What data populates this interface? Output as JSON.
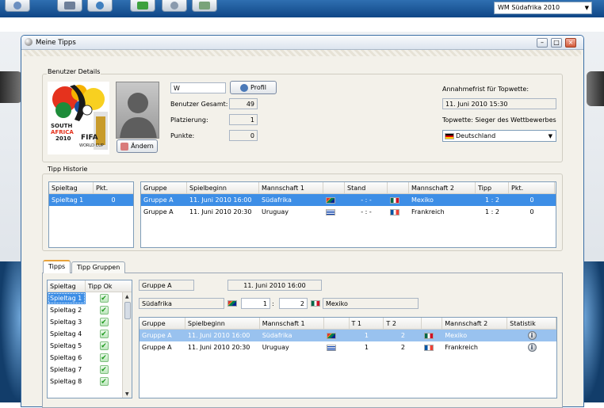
{
  "app": {
    "season_select": "WM Südafrika 2010"
  },
  "window": {
    "title": "Meine Tipps"
  },
  "user_details": {
    "group_label": "Benutzer Details",
    "logo_text": [
      "SOUTH",
      "AFRICA",
      "2010",
      "FIFA",
      "WORLD CUP"
    ],
    "change_button": "Ändern",
    "username": "W",
    "profile_button": "Profil",
    "total_label": "Benutzer Gesamt:",
    "total_value": "49",
    "rank_label": "Platzierung:",
    "rank_value": "1",
    "points_label": "Punkte:",
    "points_value": "0",
    "deadline_label": "Annahmefrist für Topwette:",
    "deadline_value": "11. Juni 2010 15:30",
    "topbet_label": "Topwette: Sieger des Wettbewerbes",
    "topbet_value": "Deutschland"
  },
  "history": {
    "group_label": "Tipp Historie",
    "matchday_headers": [
      "Spieltag",
      "Pkt."
    ],
    "matchdays": [
      {
        "day": "Spieltag 1",
        "pts": "0"
      }
    ],
    "headers": [
      "Gruppe",
      "Spielbeginn",
      "Mannschaft 1",
      "Stand",
      "Mannschaft 2",
      "Tipp",
      "Pkt."
    ],
    "rows": [
      {
        "group": "Gruppe A",
        "start": "11. Juni 2010 16:00",
        "team1": "Südafrika",
        "score": "- : -",
        "team2": "Mexiko",
        "tip": "1 : 2",
        "pts": "0"
      },
      {
        "group": "Gruppe A",
        "start": "11. Juni 2010 20:30",
        "team1": "Uruguay",
        "score": "- : -",
        "team2": "Frankreich",
        "tip": "1 : 2",
        "pts": "0"
      }
    ]
  },
  "tabs": [
    "Tipps",
    "Tipp Gruppen"
  ],
  "tipps": {
    "matchday_headers": [
      "Spieltag",
      "Tipp Ok"
    ],
    "matchdays": [
      "Spieltag 1",
      "Spieltag 2",
      "Spieltag 3",
      "Spieltag 4",
      "Spieltag 5",
      "Spieltag 6",
      "Spieltag 7",
      "Spieltag 8"
    ],
    "selected_group": "Gruppe A",
    "selected_start": "11. Juni 2010 16:00",
    "team1": "Südafrika",
    "goals1": "1",
    "separator": ":",
    "goals2": "2",
    "team2": "Mexiko",
    "headers": [
      "Gruppe",
      "Spielbeginn",
      "Mannschaft 1",
      "T 1",
      "T 2",
      "Mannschaft 2",
      "Statistik"
    ],
    "rows": [
      {
        "group": "Gruppe A",
        "start": "11. Juni 2010 16:00",
        "team1": "Südafrika",
        "t1": "1",
        "t2": "2",
        "team2": "Mexiko"
      },
      {
        "group": "Gruppe A",
        "start": "11. Juni 2010 20:30",
        "team1": "Uruguay",
        "t1": "1",
        "t2": "2",
        "team2": "Frankreich"
      }
    ]
  },
  "icons": {
    "check": "✔",
    "info": "i",
    "minimize": "–",
    "maximize": "□",
    "close": "×",
    "dropdown": "▼"
  }
}
